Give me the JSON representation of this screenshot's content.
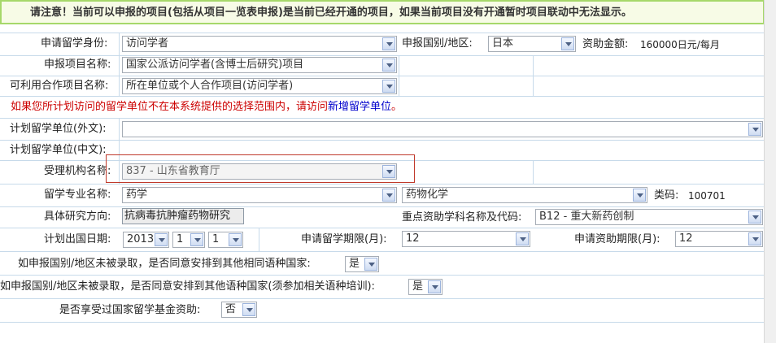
{
  "notice": "请注意！当前可以申报的项目(包括从项目一览表申报)是当前已经开通的项目，如果当前项目没有开通暂时项目联动中无法显示。",
  "identity": {
    "label": "申请留学身份:",
    "value": "访问学者"
  },
  "country": {
    "label": "申报国别/地区:",
    "value": "日本"
  },
  "funding": {
    "label": "资助金额:",
    "value": "160000日元/每月"
  },
  "project": {
    "label": "申报项目名称:",
    "value": "国家公派访问学者(含博士后研究)项目"
  },
  "coop": {
    "label": "可利用合作项目名称:",
    "value": "所在单位或个人合作项目(访问学者)"
  },
  "warning": {
    "text": "如果您所计划访问的留学单位不在本系统提供的选择范围内，请访问",
    "link": "新增留学单位",
    "end": "。"
  },
  "unit_foreign": {
    "label": "计划留学单位(外文):",
    "value": ""
  },
  "unit_cn": {
    "label": "计划留学单位(中文):"
  },
  "agency": {
    "label": "受理机构名称:",
    "value": "837 - 山东省教育厅"
  },
  "major": {
    "label": "留学专业名称:",
    "value1": "药学",
    "value2": "药物化学",
    "code_label": "类码:",
    "code": "100701"
  },
  "research": {
    "label": "具体研究方向:",
    "value": "抗病毒抗肿瘤药物研究"
  },
  "key_discipline": {
    "label": "重点资助学科名称及代码:",
    "value": "B12 - 重大新药创制"
  },
  "date": {
    "label": "计划出国日期:",
    "year": "2013",
    "month": "1",
    "day": "1"
  },
  "period": {
    "label": "申请留学期限(月):",
    "value": "12"
  },
  "fund_period": {
    "label": "申请资助期限(月):",
    "value": "12"
  },
  "q1": {
    "label": "如申报国别/地区未被录取，是否同意安排到其他相同语种国家:",
    "value": "是"
  },
  "q2": {
    "label": "如申报国别/地区未被录取，是否同意安排到其他语种国家(须参加相关语种培训):",
    "value": "是"
  },
  "q3": {
    "label": "是否享受过国家留学基金资助:",
    "value": "否"
  }
}
